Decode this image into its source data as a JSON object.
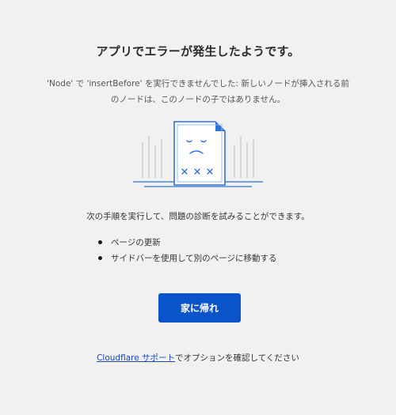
{
  "error": {
    "title": "アプリでエラーが発生したようです。",
    "message": "'Node' で 'insertBefore' を実行できませんでした: 新しいノードが挿入される前のノードは、このノードの子ではありません。"
  },
  "illustration": {
    "icon": "broken-document-icon",
    "accent_color": "#2f6fd8"
  },
  "recovery": {
    "intro": "次の手順を実行して、問題の診断を試みることができます。",
    "steps": [
      "ページの更新",
      "サイドバーを使用して別のページに移動する"
    ]
  },
  "actions": {
    "home_button_label": "家に帰れ",
    "home_button_color": "#0a53c9"
  },
  "support": {
    "link_text": "Cloudflare サポート",
    "suffix_text": "でオプションを確認してください"
  }
}
